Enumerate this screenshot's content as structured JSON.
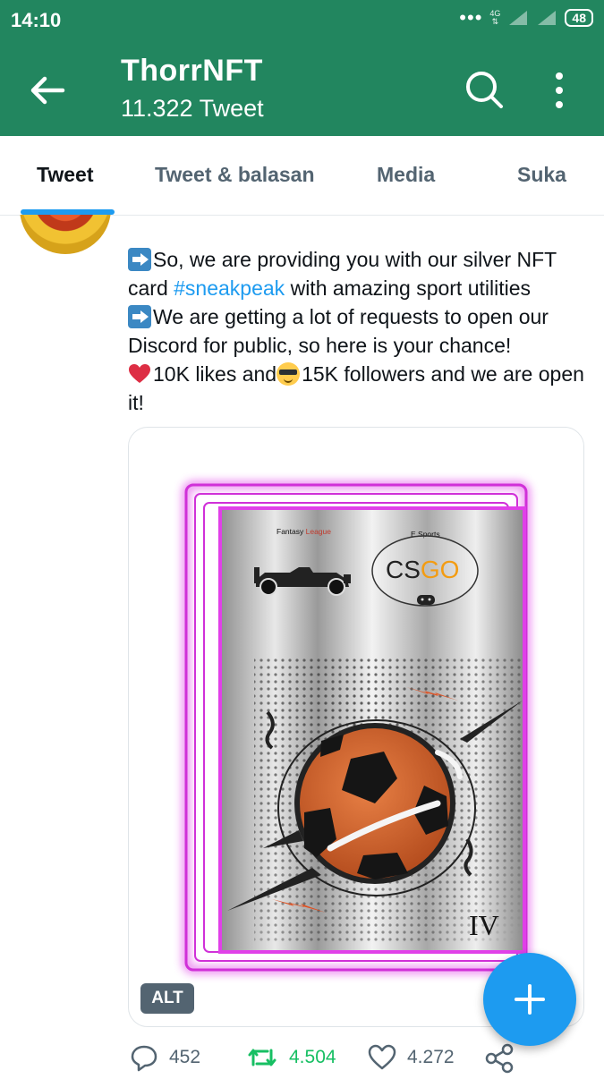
{
  "status_bar": {
    "time": "14:10",
    "network": "4G",
    "battery": "48"
  },
  "header": {
    "title": "ThorrNFT",
    "subtitle": "11.322 Tweet"
  },
  "tabs": [
    {
      "label": "Tweet",
      "active": true
    },
    {
      "label": "Tweet & balasan",
      "active": false
    },
    {
      "label": "Media",
      "active": false
    },
    {
      "label": "Suka",
      "active": false
    }
  ],
  "tweet": {
    "line1": "So, we are providing you with our silver NFT card ",
    "hashtag": "#sneakpeak",
    "line1_end": " with amazing sport utilities",
    "line2": "We are getting a lot of requests to open our Discord for public, so here is your chance!",
    "line3_a": "10K likes and",
    "line3_b": "15K followers and we are open it!",
    "emoji": [
      "right-arrow-emoji",
      "red-heart-emoji",
      "smiling-face-with-sunglasses-emoji"
    ]
  },
  "card": {
    "fantasy_text": "Fantasy ",
    "league_text": "League",
    "esports_text": "E Sports",
    "csgo_cs": "CS",
    "csgo_go": "GO",
    "roman": "IV",
    "frame_color": "#e040e8",
    "ball_color": "#d9692f"
  },
  "media": {
    "alt_badge": "ALT"
  },
  "actions": {
    "replies": "452",
    "retweets": "4.504",
    "likes": "4.272"
  },
  "colors": {
    "header_bg": "#22865f",
    "accent": "#1d9bf0",
    "retweet": "#17bf63",
    "muted": "#536471"
  }
}
